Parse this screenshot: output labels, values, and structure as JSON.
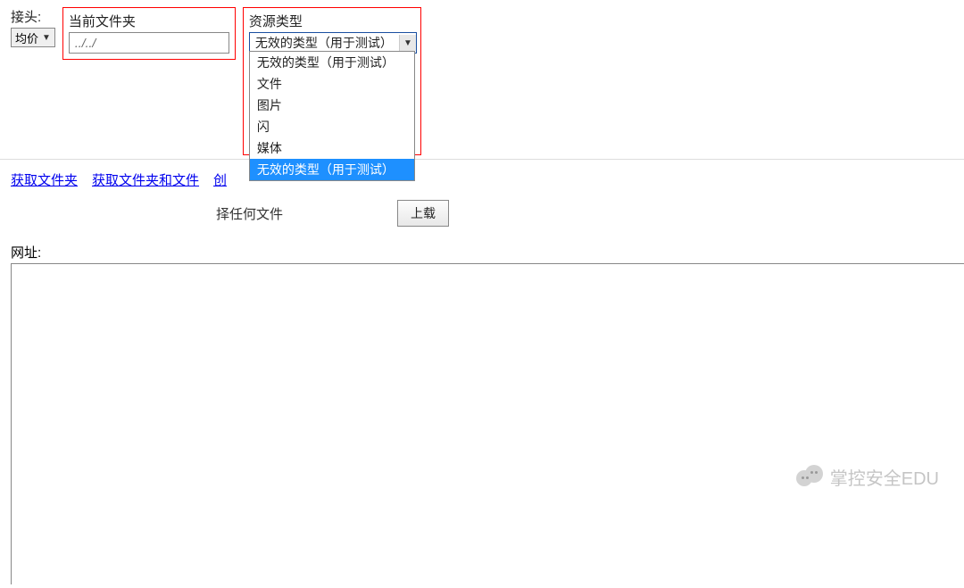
{
  "header": {
    "connector_label": "接头:",
    "connector_value": "均价",
    "current_folder_label": "当前文件夹",
    "current_folder_value": "../../",
    "resource_type_label": "资源类型",
    "resource_type_selected": "无效的类型（用于测试）"
  },
  "dropdown": {
    "options": [
      "无效的类型（用于测试）",
      "文件",
      "图片",
      "闪",
      "媒体",
      "无效的类型（用于测试）"
    ],
    "selected_index": 5
  },
  "links": {
    "get_folders": "获取文件夹",
    "get_folders_files": "获取文件夹和文件",
    "create_partial": "创"
  },
  "file_area": {
    "hint_partial": "择任何文件",
    "upload_label": "上载"
  },
  "url_section": {
    "label": "网址:"
  },
  "watermark": {
    "text": "掌控安全EDU"
  }
}
